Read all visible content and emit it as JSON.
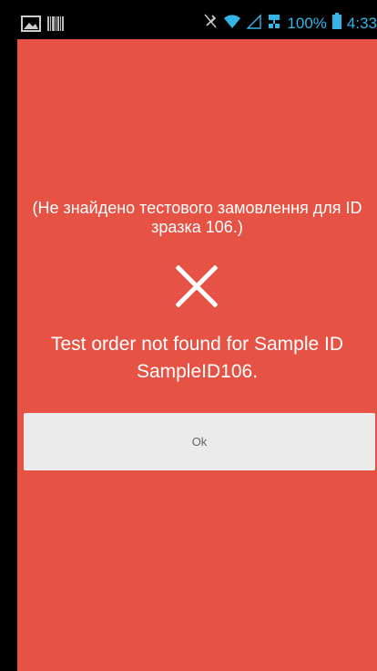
{
  "status_bar": {
    "battery": "100%",
    "time": "4:33",
    "icons": [
      "image-icon",
      "barcode-icon",
      "mute-icon",
      "wifi-icon",
      "signal-icon",
      "network-icon",
      "battery-icon"
    ]
  },
  "dialog": {
    "message_ua": "(Не знайдено тестового замовлення для ID зразка 106.)",
    "icon": "close-icon",
    "message_en": "Test order not found for Sample ID SampleID106.",
    "ok_label": "Ok"
  },
  "colors": {
    "background": "#e65244",
    "button": "#ebebeb",
    "status_accent": "#33b5e5"
  }
}
